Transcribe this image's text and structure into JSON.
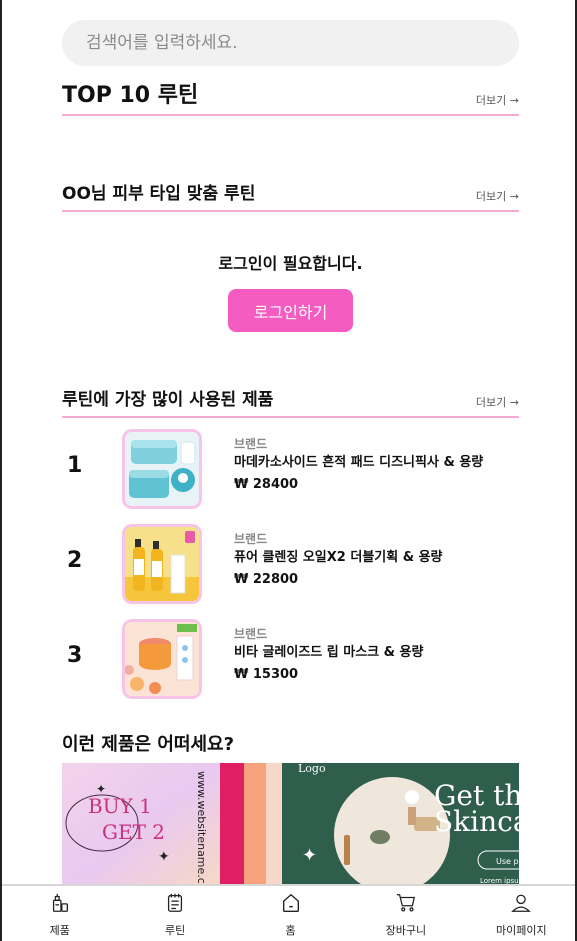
{
  "search": {
    "placeholder": "검색어를 입력하세요."
  },
  "sections": {
    "top10": {
      "title": "TOP 10 루틴",
      "more": "더보기 →"
    },
    "skin": {
      "title": "OO님 피부 타입 맞춤 루틴",
      "more": "더보기 →"
    },
    "most_used": {
      "title": "루틴에 가장 많이 사용된 제품",
      "more": "더보기 →"
    }
  },
  "login": {
    "message": "로그인이 필요합니다.",
    "button": "로그인하기"
  },
  "products": [
    {
      "rank": "1",
      "brand": "브랜드",
      "name": "마데카소사이드 흔적 패드 디즈니픽사 & 용량",
      "price": "₩ 28400"
    },
    {
      "rank": "2",
      "brand": "브랜드",
      "name": "퓨어 클렌징 오일X2 더블기획 & 용량",
      "price": "₩ 22800"
    },
    {
      "rank": "3",
      "brand": "브랜드",
      "name": "비타 글레이즈드 립 마스크 & 용량",
      "price": "₩ 15300"
    }
  ],
  "recommend": {
    "title": "이런 제품은 어떠세요?",
    "banner": {
      "buy": "BUY 1",
      "get": "GET 2",
      "website": "www.websitename.com",
      "logo": "Logo",
      "headline1": "Get th",
      "headline2": "Skinca",
      "cta": "Use pr",
      "lorem": "Lorem ipsum d"
    }
  },
  "nav": [
    {
      "label": "제품",
      "icon": "product-icon"
    },
    {
      "label": "루틴",
      "icon": "routine-icon"
    },
    {
      "label": "홈",
      "icon": "home-icon"
    },
    {
      "label": "장바구니",
      "icon": "cart-icon"
    },
    {
      "label": "마이페이지",
      "icon": "mypage-icon"
    }
  ],
  "colors": {
    "accent": "#f55cc2",
    "divider": "#f5a9d3",
    "thumb_border": "#f7c3e6"
  }
}
